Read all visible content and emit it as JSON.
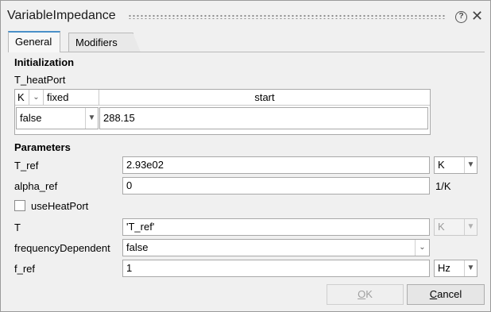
{
  "window": {
    "title": "VariableImpedance"
  },
  "tabs": [
    {
      "label": "General",
      "active": true
    },
    {
      "label": "Modifiers",
      "active": false
    }
  ],
  "initialization": {
    "heading": "Initialization",
    "variable": "T_heatPort",
    "table": {
      "unit": "K",
      "fixed_header": "fixed",
      "start_header": "start",
      "fixed_value": "false",
      "start_value": "288.15"
    }
  },
  "parameters": {
    "heading": "Parameters",
    "T_ref": {
      "label": "T_ref",
      "value": "2.93e02",
      "unit": "K"
    },
    "alpha_ref": {
      "label": "alpha_ref",
      "value": "0",
      "unit": "1/K"
    },
    "useHeatPort": {
      "label": "useHeatPort",
      "checked": false
    },
    "T": {
      "label": "T",
      "value": "'T_ref'",
      "unit": "K"
    },
    "frequencyDependent": {
      "label": "frequencyDependent",
      "value": "false"
    },
    "f_ref": {
      "label": "f_ref",
      "value": "1",
      "unit": "Hz"
    }
  },
  "buttons": {
    "ok": {
      "label": "OK",
      "mnemonic": "O",
      "rest": "K",
      "enabled": false
    },
    "cancel": {
      "label": "Cancel",
      "mnemonic": "C",
      "rest": "ancel"
    }
  },
  "icons": {
    "help": "help-icon",
    "close": "close-icon",
    "dropdown": "chevron-down-icon"
  },
  "colors": {
    "tab_accent": "#4a90c8",
    "background": "#f0f0f0"
  }
}
